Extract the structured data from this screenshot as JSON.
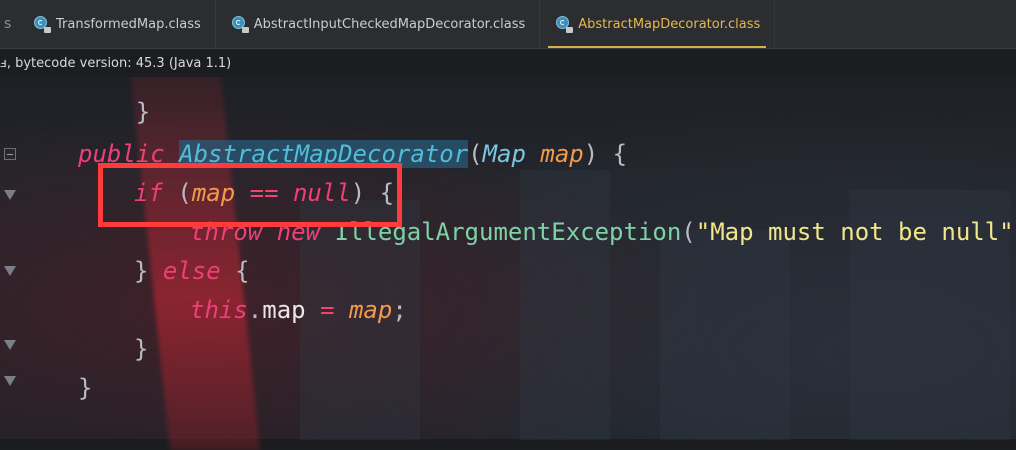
{
  "tabs": [
    {
      "label": "TransformedMap.class",
      "icon": "class-file-icon",
      "active": false
    },
    {
      "label": "AbstractInputCheckedMapDecorator.class",
      "icon": "class-file-icon",
      "active": false
    },
    {
      "label": "AbstractMapDecorator.class",
      "icon": "class-file-icon",
      "active": true
    }
  ],
  "tab_overflow_label": "s",
  "info_bar": {
    "text": "ⅎ, bytecode version: 45.3 (Java 1.1)"
  },
  "code": {
    "l0": {
      "brace": "}"
    },
    "l1": {
      "kw_public": "public",
      "ctor": "AbstractMapDecorator",
      "lparen": "(",
      "type": "Map",
      "param": "map",
      "rparen_brace": ") {"
    },
    "l2": {
      "kw_if": "if",
      "lparen": "(",
      "var": "map",
      "op": "==",
      "kw_null": "null",
      "rparen_brace": ") {"
    },
    "l3": {
      "kw_throw": "throw",
      "kw_new": "new",
      "exc": "IllegalArgumentException",
      "lparen": "(",
      "str": "\"Map must not be null\"",
      "end": ");"
    },
    "l4": {
      "rbrace": "}",
      "kw_else": "else",
      "lbrace": "{"
    },
    "l5": {
      "kw_this": "this",
      "dot": ".",
      "field": "map",
      "op": "=",
      "var": "map",
      "semi": ";"
    },
    "l6": {
      "rbrace": "}"
    },
    "l7": {
      "rbrace": "}"
    }
  },
  "colors": {
    "annotation_box": "#ff3b3b",
    "active_tab": "#e6b84d"
  }
}
